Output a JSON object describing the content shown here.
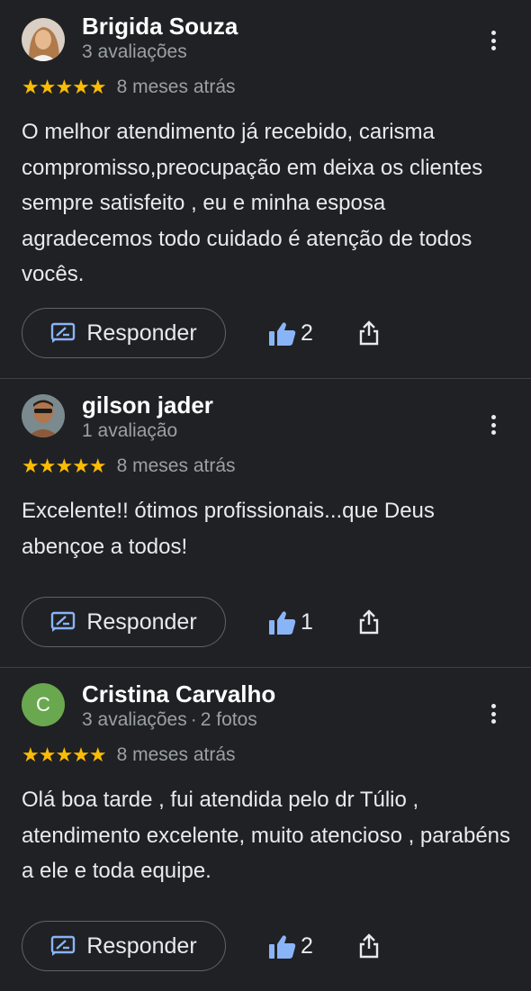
{
  "colors": {
    "background": "#202124",
    "stars": "#fbbc04",
    "like_icon": "#8ab4f8",
    "secondary_text": "#9aa0a6",
    "avatar_letter_bg": "#6aa84f"
  },
  "reviews": [
    {
      "name": "Brigida Souza",
      "count_label": "3 avaliações",
      "photos_label": "",
      "stars": "★★★★★",
      "rating": 5,
      "date": "8 meses atrás",
      "text": "O melhor atendimento já recebido, carisma compromisso,preocupação em deixa os clientes sempre satisfeito , eu e minha esposa agradecemos todo cuidado é atenção de todos vocês.",
      "reply_label": "Responder",
      "likes": "2"
    },
    {
      "name": "gilson jader",
      "count_label": "1 avaliação",
      "photos_label": "",
      "stars": "★★★★★",
      "rating": 5,
      "date": "8 meses atrás",
      "text": "Excelente!! ótimos profissionais...que Deus abençoe a todos!",
      "reply_label": "Responder",
      "likes": "1"
    },
    {
      "name": "Cristina Carvalho",
      "avatar_letter": "C",
      "count_label": "3 avaliações",
      "separator": "·",
      "photos_label": "2 fotos",
      "stars": "★★★★★",
      "rating": 5,
      "date": "8 meses atrás",
      "text": "Olá boa tarde , fui atendida pelo dr Túlio , atendimento excelente, muito atencioso , parabéns a ele e toda equipe.",
      "reply_label": "Responder",
      "likes": "2"
    }
  ]
}
